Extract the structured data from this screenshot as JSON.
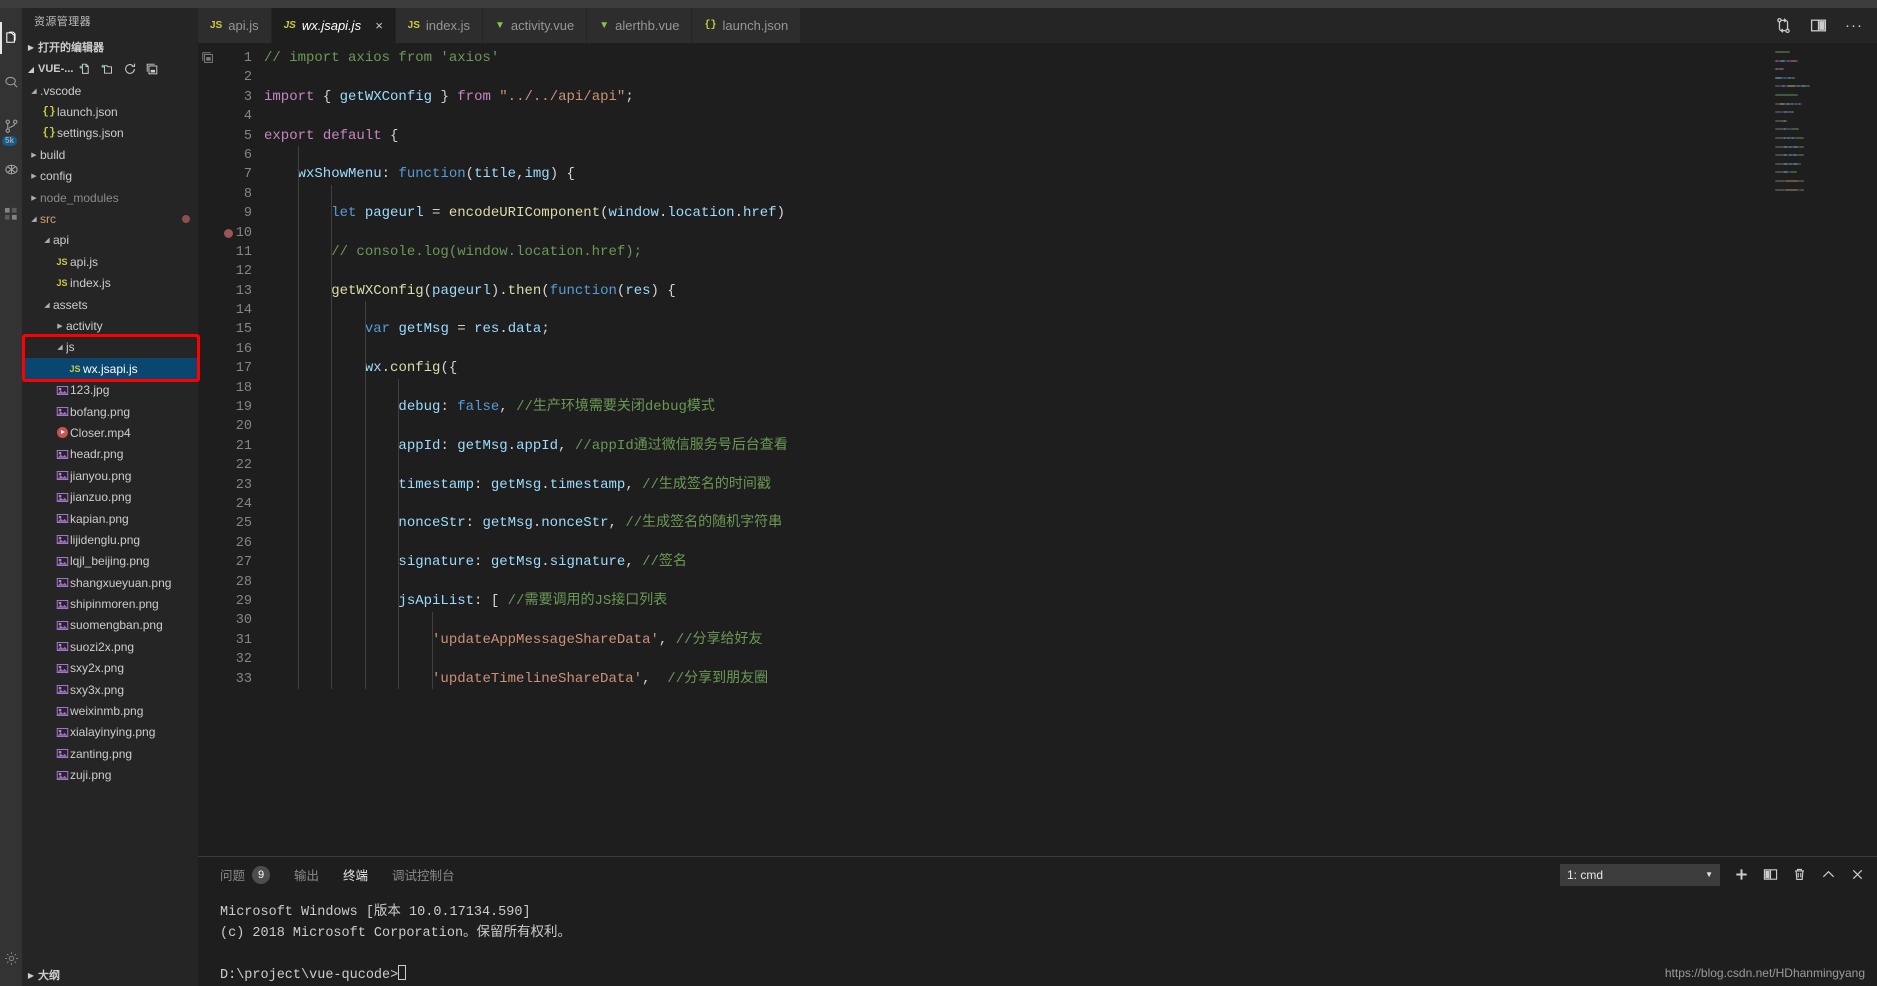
{
  "activity_bar": {
    "items": [
      {
        "name": "explorer",
        "icon": "files-icon",
        "active": true,
        "badge": ""
      },
      {
        "name": "search",
        "icon": "search-icon",
        "active": false,
        "badge": ""
      },
      {
        "name": "source-control",
        "icon": "source-control-icon",
        "active": false,
        "badge": "5k"
      },
      {
        "name": "debug",
        "icon": "debug-icon",
        "active": false,
        "badge": ""
      },
      {
        "name": "extensions",
        "icon": "extensions-icon",
        "active": false,
        "badge": ""
      }
    ],
    "settings_label": "gear-icon"
  },
  "sidebar": {
    "title": "资源管理器",
    "open_editors_label": "打开的编辑器",
    "project_label": "VUE-...",
    "actions": [
      "new-file-icon",
      "new-folder-icon",
      "refresh-icon",
      "collapse-all-icon"
    ],
    "outline_label": "大纲",
    "tree": [
      {
        "label": ".vscode",
        "type": "folder",
        "depth": 1,
        "expanded": true
      },
      {
        "label": "launch.json",
        "type": "json",
        "depth": 2
      },
      {
        "label": "settings.json",
        "type": "json",
        "depth": 2
      },
      {
        "label": "build",
        "type": "folder",
        "depth": 1,
        "expanded": false
      },
      {
        "label": "config",
        "type": "folder",
        "depth": 1,
        "expanded": false
      },
      {
        "label": "node_modules",
        "type": "folder",
        "depth": 1,
        "expanded": false,
        "dim": true
      },
      {
        "label": "src",
        "type": "folder",
        "depth": 1,
        "expanded": true,
        "modified": true,
        "dot": true
      },
      {
        "label": "api",
        "type": "folder",
        "depth": 2,
        "expanded": true
      },
      {
        "label": "api.js",
        "type": "js",
        "depth": 3
      },
      {
        "label": "index.js",
        "type": "js",
        "depth": 3
      },
      {
        "label": "assets",
        "type": "folder",
        "depth": 2,
        "expanded": true
      },
      {
        "label": "activity",
        "type": "folder",
        "depth": 3,
        "expanded": false
      },
      {
        "label": "js",
        "type": "folder",
        "depth": 3,
        "expanded": true
      },
      {
        "label": "wx.jsapi.js",
        "type": "js",
        "depth": 4,
        "selected": true
      },
      {
        "label": "123.jpg",
        "type": "image",
        "depth": 3
      },
      {
        "label": "bofang.png",
        "type": "image",
        "depth": 3
      },
      {
        "label": "Closer.mp4",
        "type": "video",
        "depth": 3
      },
      {
        "label": "headr.png",
        "type": "image",
        "depth": 3
      },
      {
        "label": "jianyou.png",
        "type": "image",
        "depth": 3
      },
      {
        "label": "jianzuo.png",
        "type": "image",
        "depth": 3
      },
      {
        "label": "kapian.png",
        "type": "image",
        "depth": 3
      },
      {
        "label": "lijidenglu.png",
        "type": "image",
        "depth": 3
      },
      {
        "label": "lqjl_beijing.png",
        "type": "image",
        "depth": 3
      },
      {
        "label": "shangxueyuan.png",
        "type": "image",
        "depth": 3
      },
      {
        "label": "shipinmoren.png",
        "type": "image",
        "depth": 3
      },
      {
        "label": "suomengban.png",
        "type": "image",
        "depth": 3
      },
      {
        "label": "suozi2x.png",
        "type": "image",
        "depth": 3
      },
      {
        "label": "sxy2x.png",
        "type": "image",
        "depth": 3
      },
      {
        "label": "sxy3x.png",
        "type": "image",
        "depth": 3
      },
      {
        "label": "weixinmb.png",
        "type": "image",
        "depth": 3
      },
      {
        "label": "xialayinying.png",
        "type": "image",
        "depth": 3
      },
      {
        "label": "zanting.png",
        "type": "image",
        "depth": 3
      },
      {
        "label": "zuji.png",
        "type": "image",
        "depth": 3
      }
    ]
  },
  "tabs": [
    {
      "label": "api.js",
      "kind": "js",
      "active": false
    },
    {
      "label": "wx.jsapi.js",
      "kind": "js",
      "active": true,
      "close": "×"
    },
    {
      "label": "index.js",
      "kind": "js",
      "active": false
    },
    {
      "label": "activity.vue",
      "kind": "vue",
      "active": false
    },
    {
      "label": "alerthb.vue",
      "kind": "vue",
      "active": false
    },
    {
      "label": "launch.json",
      "kind": "json",
      "active": false
    }
  ],
  "tabbar_actions": [
    "split-sync-icon",
    "split-editor-icon",
    "more-actions-icon"
  ],
  "editor": {
    "first_line": 1,
    "breakpoint_line": 10,
    "lines": [
      {
        "n": 1,
        "segments": [
          {
            "t": "// import axios from 'axios'",
            "c": "cmt"
          }
        ],
        "indent": 0
      },
      {
        "n": 2,
        "segments": [],
        "indent": 0
      },
      {
        "n": 3,
        "segments": [
          {
            "t": "import ",
            "c": "kw"
          },
          {
            "t": "{ ",
            "c": "pl"
          },
          {
            "t": "getWXConfig",
            "c": "var"
          },
          {
            "t": " } ",
            "c": "pl"
          },
          {
            "t": "from ",
            "c": "kw"
          },
          {
            "t": "\"../../api/api\"",
            "c": "str"
          },
          {
            "t": ";",
            "c": "pl"
          }
        ],
        "indent": 0
      },
      {
        "n": 4,
        "segments": [],
        "indent": 0
      },
      {
        "n": 5,
        "segments": [
          {
            "t": "export ",
            "c": "kw"
          },
          {
            "t": "default ",
            "c": "kw"
          },
          {
            "t": "{",
            "c": "pl"
          }
        ],
        "indent": 0
      },
      {
        "n": 6,
        "segments": [],
        "indent": 1
      },
      {
        "n": 7,
        "segments": [
          {
            "t": "    wxShowMenu",
            "c": "var"
          },
          {
            "t": ": ",
            "c": "pl"
          },
          {
            "t": "function",
            "c": "kw2"
          },
          {
            "t": "(",
            "c": "pl"
          },
          {
            "t": "title",
            "c": "var"
          },
          {
            "t": ",",
            "c": "pl"
          },
          {
            "t": "img",
            "c": "var"
          },
          {
            "t": ") {",
            "c": "pl"
          }
        ],
        "indent": 1
      },
      {
        "n": 8,
        "segments": [],
        "indent": 2
      },
      {
        "n": 9,
        "segments": [
          {
            "t": "        ",
            "c": "pl"
          },
          {
            "t": "let",
            "c": "kw2"
          },
          {
            "t": " ",
            "c": "pl"
          },
          {
            "t": "pageurl",
            "c": "var"
          },
          {
            "t": " = ",
            "c": "pl"
          },
          {
            "t": "encodeURIComponent",
            "c": "fn"
          },
          {
            "t": "(",
            "c": "pl"
          },
          {
            "t": "window",
            "c": "var"
          },
          {
            "t": ".",
            "c": "pl"
          },
          {
            "t": "location",
            "c": "var"
          },
          {
            "t": ".",
            "c": "pl"
          },
          {
            "t": "href",
            "c": "var"
          },
          {
            "t": ")",
            "c": "pl"
          }
        ],
        "indent": 2
      },
      {
        "n": 10,
        "segments": [],
        "indent": 2
      },
      {
        "n": 11,
        "segments": [
          {
            "t": "        // console.log(window.location.href);",
            "c": "cmt"
          }
        ],
        "indent": 2
      },
      {
        "n": 12,
        "segments": [],
        "indent": 2
      },
      {
        "n": 13,
        "segments": [
          {
            "t": "        ",
            "c": "pl"
          },
          {
            "t": "getWXConfig",
            "c": "fn"
          },
          {
            "t": "(",
            "c": "pl"
          },
          {
            "t": "pageurl",
            "c": "var"
          },
          {
            "t": ").",
            "c": "pl"
          },
          {
            "t": "then",
            "c": "fn"
          },
          {
            "t": "(",
            "c": "pl"
          },
          {
            "t": "function",
            "c": "kw2"
          },
          {
            "t": "(",
            "c": "pl"
          },
          {
            "t": "res",
            "c": "var"
          },
          {
            "t": ") {",
            "c": "pl"
          }
        ],
        "indent": 2
      },
      {
        "n": 14,
        "segments": [],
        "indent": 3
      },
      {
        "n": 15,
        "segments": [
          {
            "t": "            ",
            "c": "pl"
          },
          {
            "t": "var",
            "c": "kw2"
          },
          {
            "t": " ",
            "c": "pl"
          },
          {
            "t": "getMsg",
            "c": "var"
          },
          {
            "t": " = ",
            "c": "pl"
          },
          {
            "t": "res",
            "c": "var"
          },
          {
            "t": ".",
            "c": "pl"
          },
          {
            "t": "data",
            "c": "var"
          },
          {
            "t": ";",
            "c": "pl"
          }
        ],
        "indent": 3
      },
      {
        "n": 16,
        "segments": [],
        "indent": 3
      },
      {
        "n": 17,
        "segments": [
          {
            "t": "            ",
            "c": "pl"
          },
          {
            "t": "wx",
            "c": "var"
          },
          {
            "t": ".",
            "c": "pl"
          },
          {
            "t": "config",
            "c": "fn"
          },
          {
            "t": "({",
            "c": "pl"
          }
        ],
        "indent": 3
      },
      {
        "n": 18,
        "segments": [],
        "indent": 4
      },
      {
        "n": 19,
        "segments": [
          {
            "t": "                ",
            "c": "pl"
          },
          {
            "t": "debug",
            "c": "var"
          },
          {
            "t": ": ",
            "c": "pl"
          },
          {
            "t": "false",
            "c": "kw2"
          },
          {
            "t": ", ",
            "c": "pl"
          },
          {
            "t": "//生产环境需要关闭debug模式",
            "c": "cmt"
          }
        ],
        "indent": 4
      },
      {
        "n": 20,
        "segments": [],
        "indent": 4
      },
      {
        "n": 21,
        "segments": [
          {
            "t": "                ",
            "c": "pl"
          },
          {
            "t": "appId",
            "c": "var"
          },
          {
            "t": ": ",
            "c": "pl"
          },
          {
            "t": "getMsg",
            "c": "var"
          },
          {
            "t": ".",
            "c": "pl"
          },
          {
            "t": "appId",
            "c": "var"
          },
          {
            "t": ", ",
            "c": "pl"
          },
          {
            "t": "//appId通过微信服务号后台查看",
            "c": "cmt"
          }
        ],
        "indent": 4
      },
      {
        "n": 22,
        "segments": [],
        "indent": 4
      },
      {
        "n": 23,
        "segments": [
          {
            "t": "                ",
            "c": "pl"
          },
          {
            "t": "timestamp",
            "c": "var"
          },
          {
            "t": ": ",
            "c": "pl"
          },
          {
            "t": "getMsg",
            "c": "var"
          },
          {
            "t": ".",
            "c": "pl"
          },
          {
            "t": "timestamp",
            "c": "var"
          },
          {
            "t": ", ",
            "c": "pl"
          },
          {
            "t": "//生成签名的时间戳",
            "c": "cmt"
          }
        ],
        "indent": 4
      },
      {
        "n": 24,
        "segments": [],
        "indent": 4
      },
      {
        "n": 25,
        "segments": [
          {
            "t": "                ",
            "c": "pl"
          },
          {
            "t": "nonceStr",
            "c": "var"
          },
          {
            "t": ": ",
            "c": "pl"
          },
          {
            "t": "getMsg",
            "c": "var"
          },
          {
            "t": ".",
            "c": "pl"
          },
          {
            "t": "nonceStr",
            "c": "var"
          },
          {
            "t": ", ",
            "c": "pl"
          },
          {
            "t": "//生成签名的随机字符串",
            "c": "cmt"
          }
        ],
        "indent": 4
      },
      {
        "n": 26,
        "segments": [],
        "indent": 4
      },
      {
        "n": 27,
        "segments": [
          {
            "t": "                ",
            "c": "pl"
          },
          {
            "t": "signature",
            "c": "var"
          },
          {
            "t": ": ",
            "c": "pl"
          },
          {
            "t": "getMsg",
            "c": "var"
          },
          {
            "t": ".",
            "c": "pl"
          },
          {
            "t": "signature",
            "c": "var"
          },
          {
            "t": ", ",
            "c": "pl"
          },
          {
            "t": "//签名",
            "c": "cmt"
          }
        ],
        "indent": 4
      },
      {
        "n": 28,
        "segments": [],
        "indent": 4
      },
      {
        "n": 29,
        "segments": [
          {
            "t": "                ",
            "c": "pl"
          },
          {
            "t": "jsApiList",
            "c": "var"
          },
          {
            "t": ": [ ",
            "c": "pl"
          },
          {
            "t": "//需要调用的JS接口列表",
            "c": "cmt"
          }
        ],
        "indent": 4
      },
      {
        "n": 30,
        "segments": [],
        "indent": 5
      },
      {
        "n": 31,
        "segments": [
          {
            "t": "                    ",
            "c": "pl"
          },
          {
            "t": "'updateAppMessageShareData'",
            "c": "str"
          },
          {
            "t": ", ",
            "c": "pl"
          },
          {
            "t": "//分享给好友",
            "c": "cmt"
          }
        ],
        "indent": 5
      },
      {
        "n": 32,
        "segments": [],
        "indent": 5
      },
      {
        "n": 33,
        "segments": [
          {
            "t": "                    ",
            "c": "pl"
          },
          {
            "t": "'updateTimelineShareData'",
            "c": "str"
          },
          {
            "t": ",  ",
            "c": "pl"
          },
          {
            "t": "//分享到朋友圈",
            "c": "cmt"
          }
        ],
        "indent": 5
      }
    ]
  },
  "panel": {
    "tabs": [
      {
        "label": "问题",
        "count": "9",
        "active": false
      },
      {
        "label": "输出",
        "count": "",
        "active": false
      },
      {
        "label": "终端",
        "count": "",
        "active": true
      },
      {
        "label": "调试控制台",
        "count": "",
        "active": false
      }
    ],
    "terminal_select": "1: cmd",
    "actions": [
      "add-terminal-icon",
      "split-terminal-icon",
      "kill-terminal-icon",
      "maximize-panel-icon",
      "close-panel-icon"
    ],
    "terminal_text": "Microsoft Windows [版本 10.0.17134.590]\n(c) 2018 Microsoft Corporation。保留所有权利。\n\nD:\\project\\vue-qucode>"
  },
  "watermark": "https://blog.csdn.net/HDhanmingyang",
  "colors": {
    "accent": "#007acc",
    "selection": "#094771",
    "annotation": "#ff0000",
    "js_icon": "#cbcb41",
    "vue_icon": "#8dc149",
    "image_icon": "#b57edc"
  }
}
